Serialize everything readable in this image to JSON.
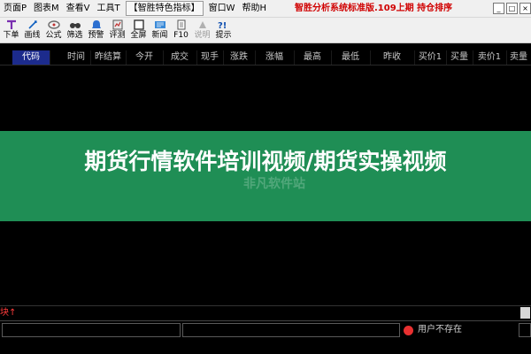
{
  "menubar": {
    "items": [
      "页面P",
      "图表M",
      "查看V",
      "工具T",
      "【智胜特色指标】",
      "窗口W",
      "帮助H"
    ],
    "announcement": "智胜分析系统标准版.109上期 持仓排序",
    "controls": [
      "_",
      "□",
      "×"
    ]
  },
  "toolbar": {
    "tools": [
      {
        "label": "下单",
        "icon": "order-icon"
      },
      {
        "label": "画线",
        "icon": "draw-line-icon"
      },
      {
        "label": "公式",
        "icon": "formula-icon"
      },
      {
        "label": "筛选",
        "icon": "filter-icon"
      },
      {
        "label": "预警",
        "icon": "alert-icon"
      },
      {
        "label": "评测",
        "icon": "evaluate-icon"
      },
      {
        "label": "全屏",
        "icon": "fullscreen-icon"
      },
      {
        "label": "新闻",
        "icon": "news-icon"
      },
      {
        "label": "F10",
        "icon": "f10-icon"
      },
      {
        "label": "说明",
        "icon": "help-icon"
      },
      {
        "label": "提示",
        "icon": "tip-icon"
      }
    ]
  },
  "columns": [
    "代码",
    "时间",
    "昨结算",
    "今开",
    "成交",
    "现手",
    "涨跌",
    "涨幅",
    "最高",
    "最低",
    "昨收",
    "买价1",
    "买量",
    "卖价1",
    "卖量"
  ],
  "banner": {
    "title": "期货行情软件培训视频/期货实操视频",
    "watermark": "非凡软件站"
  },
  "bottom": {
    "block_tab": "块↑"
  },
  "status": {
    "text": "用户不存在"
  },
  "colors": {
    "banner_bg": "#1f8e55",
    "active_header": "#1c2b8c",
    "announcement": "#d00000"
  }
}
